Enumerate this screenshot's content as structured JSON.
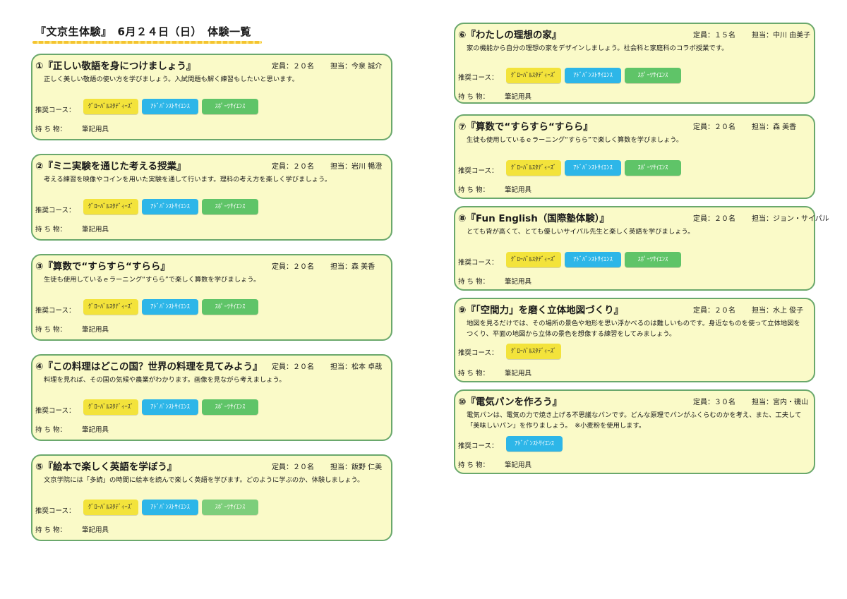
{
  "header": {
    "title": "『文京生体験』　6月２４日（日）　体験一覧"
  },
  "labels": {
    "course": "推奨コース：",
    "belongings": "持 ち 物："
  },
  "course_names": {
    "global": "ｸﾞﾛｰﾊﾞﾙｽﾀﾃﾞｨｰｽﾞ",
    "advanced": "ｱﾄﾞﾊﾞﾝｽﾄｻｲｴﾝｽ",
    "sports": "ｽﾎﾟｰﾂｻｲｴﾝｽ"
  },
  "colors": {
    "card_bg": "#fafac8",
    "card_border": "#6aa86c",
    "global": "#f3e33b",
    "advanced": "#2db6e8",
    "sports": "#5fc468"
  },
  "cards": [
    {
      "title": "①『正しい敬語を身につけましょう』",
      "capacity": "定員：２０名",
      "staff": "担当：今泉 誠介",
      "desc": "正しく美しい敬語の使い方を学びましょう。入試問題も解く練習もしたいと思います。",
      "courses": [
        "global",
        "advanced",
        "sports"
      ],
      "belongings": "筆記用具"
    },
    {
      "title": "②『ミニ実験を通じた考える授業』",
      "capacity": "定員：２０名",
      "staff": "担当：岩川 暢澄",
      "desc": "考える練習を映像やコインを用いた実験を通して行います。理科の考え方を楽しく学びましょう。",
      "courses": [
        "global",
        "advanced",
        "sports"
      ],
      "belongings": "筆記用具"
    },
    {
      "title": "③『算数で“すらすら“すらら』",
      "capacity": "定員：２０名",
      "staff": "担当：森 美香",
      "desc": "生徒も使用しているｅラーニング“すらら”で楽しく算数を学びましょう。",
      "courses": [
        "global",
        "advanced",
        "sports"
      ],
      "belongings": "筆記用具"
    },
    {
      "title": "④『この料理はどこの国？世界の料理を見てみよう』",
      "capacity": "定員：２０名",
      "staff": "担当：松本 卓哉",
      "desc": "料理を見れば、その国の気候や農業がわかります。画像を見ながら考えましょう。",
      "courses": [
        "global",
        "advanced",
        "sports"
      ],
      "belongings": "筆記用具"
    },
    {
      "title": "⑤『絵本で楽しく英語を学ぼう』",
      "capacity": "定員：２０名",
      "staff": "担当：飯野 仁美",
      "desc": "文京学院には「多読」の時間に絵本を読んで楽しく英語を学びます。どのように学ぶのか、体験しましょう。",
      "courses": [
        "global",
        "advanced",
        "sports"
      ],
      "belongings": "筆記用具"
    },
    {
      "title": "⑥『わたしの理想の家』",
      "capacity": "定員：１５名",
      "staff": "担当：中川 由美子",
      "desc": "家の機能から自分の理想の家をデザインしましょう。社会科と家庭科のコラボ授業です。",
      "courses": [
        "global",
        "advanced",
        "sports"
      ],
      "belongings": "筆記用具"
    },
    {
      "title": "⑦『算数で“すらすら“すらら』",
      "capacity": "定員：２０名",
      "staff": "担当：森 美香",
      "desc": "生徒も使用しているｅラーニング“すらら”で楽しく算数を学びましょう。",
      "courses": [
        "global",
        "advanced",
        "sports"
      ],
      "belongings": "筆記用具"
    },
    {
      "title": "⑧『Fun English（国際塾体験）』",
      "capacity": "定員：２０名",
      "staff": "担当：ジョン・サイパル",
      "desc": "とても背が高くて、とても優しいサイパル先生と楽しく英語を学びましょう。",
      "courses": [
        "global",
        "advanced",
        "sports"
      ],
      "belongings": "筆記用具"
    },
    {
      "title": "⑨『「空間力」を磨く立体地図づくり』",
      "capacity": "定員：２０名",
      "staff": "担当：水上 俊子",
      "desc": "地図を見るだけでは、その場所の景色や地形を思い浮かべるのは難しいものです。身近なものを使って立体地図をつくり、平面の地図から立体の景色を想像する練習をしてみましょう。",
      "courses": [
        "global"
      ],
      "belongings": "筆記用具"
    },
    {
      "title": "⑩『電気パンを作ろう』",
      "capacity": "定員：３０名",
      "staff": "担当：宮内・磯山",
      "desc": "電気パンは、電気の力で焼き上げる不思議なパンです。どんな原理でパンがふくらむのかを考え、また、工夫して「美味しいパン」を作りましょう。　※小麦粉を使用します。",
      "courses": [
        "advanced"
      ],
      "belongings": "筆記用具"
    }
  ]
}
